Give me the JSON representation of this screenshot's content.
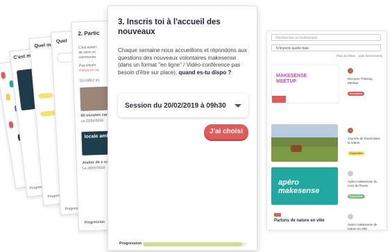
{
  "main": {
    "title": "3. Inscris toi à l'accueil des nouveaux",
    "description": "Chaque semaine nous accueillons et répondons aux questions des nouveaux volontaires makesense (dans un format \"en ligne\" / Vidéo-conférence pas besoin d'être sur place),",
    "description_bold": "quand es-tu dispo ?",
    "session_value": "Session du 20/02/2019 à 09h30",
    "choose_button": "J'ai choisi",
    "progress_label": "Progression",
    "progress_fraction": 0.95
  },
  "cards": {
    "c2_title": "C'est make",
    "c3_title": "Quel ou te",
    "c4_title": "Quel",
    "c5_title": "2. Partic",
    "c5_line1": "C'est essen",
    "c5_line2": "de vivre un",
    "c5_line3": "communau",
    "c5_line4": "Pas d'évén",
    "c5_line5": "Parles-en au",
    "c5_script": "Scrollez ici",
    "c5_item1": "60 minutes canapé - Se",
    "c5_item1_sub": "Le 22/02/2019",
    "c5_item2_img": "locale amba",
    "c5_item3": "Atelier de c communa",
    "c5_item3_sub": "Le 26/02/2019",
    "progress_label": "Progression"
  },
  "panel": {
    "search_placeholder": "Rechercher un événement",
    "date_value": "N'importe quelle date",
    "filters": [
      "Plus de filtres",
      "Liste événements"
    ],
    "events": [
      {
        "img_text": "MAKESENSE MEETUP",
        "side": "Discover Thinking Meetup",
        "tag": "Inscription"
      },
      {
        "img_text": "",
        "side": "Journée de travail dans la nature",
        "tag": "Disponible"
      },
      {
        "img_text": "apéro makesense",
        "side": "Apéro makesense du mois de février",
        "tag": "Disponible"
      },
      {
        "img_text": "Parlons de nature en ville",
        "side": "Apéro makesense de nature en ville",
        "tag": ""
      }
    ]
  },
  "colors": {
    "accent": "#e05a5a",
    "progress": "#cfe090",
    "yellow": "#f7e36b",
    "teal": "#21a8a0"
  }
}
